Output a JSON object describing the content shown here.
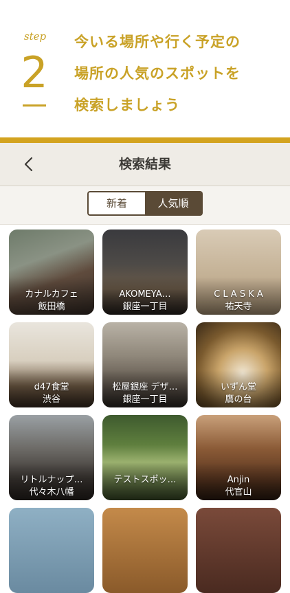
{
  "step": {
    "word": "step",
    "number": "2",
    "lines": [
      "今いる場所や行く予定の",
      "場所の人気のスポットを",
      "検索しましょう"
    ]
  },
  "navbar": {
    "title": "検索結果",
    "back_icon": "chevron-left-icon"
  },
  "tabs": {
    "items": [
      {
        "label": "新着",
        "active": false
      },
      {
        "label": "人気順",
        "active": true
      }
    ]
  },
  "colors": {
    "accent": "#c9a227",
    "rule": "#d3a31f",
    "segment": "#5a4a36",
    "navbar_bg": "#efece6"
  },
  "spots": [
    {
      "name": "カナルカフェ",
      "area": "飯田橋"
    },
    {
      "name": "AKOMEYA…",
      "area": "銀座一丁目"
    },
    {
      "name": "C L A S K A",
      "area": "祐天寺"
    },
    {
      "name": "d47食堂",
      "area": "渋谷"
    },
    {
      "name": "松屋銀座 デザ…",
      "area": "銀座一丁目"
    },
    {
      "name": "いずん堂",
      "area": "鷹の台"
    },
    {
      "name": "リトルナップ…",
      "area": "代々木八幡"
    },
    {
      "name": "テストスポッ…",
      "area": ""
    },
    {
      "name": "Anjin",
      "area": "代官山"
    }
  ]
}
